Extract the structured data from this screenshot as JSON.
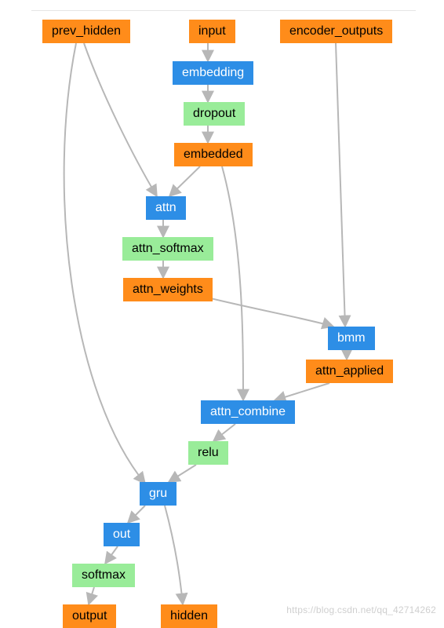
{
  "nodes": {
    "prev_hidden": {
      "label": "prev_hidden",
      "color": "orange"
    },
    "input": {
      "label": "input",
      "color": "orange"
    },
    "encoder_outputs": {
      "label": "encoder_outputs",
      "color": "orange"
    },
    "embedding": {
      "label": "embedding",
      "color": "blue"
    },
    "dropout": {
      "label": "dropout",
      "color": "green"
    },
    "embedded": {
      "label": "embedded",
      "color": "orange"
    },
    "attn": {
      "label": "attn",
      "color": "blue"
    },
    "attn_softmax": {
      "label": "attn_softmax",
      "color": "green"
    },
    "attn_weights": {
      "label": "attn_weights",
      "color": "orange"
    },
    "bmm": {
      "label": "bmm",
      "color": "blue"
    },
    "attn_applied": {
      "label": "attn_applied",
      "color": "orange"
    },
    "attn_combine": {
      "label": "attn_combine",
      "color": "blue"
    },
    "relu": {
      "label": "relu",
      "color": "green"
    },
    "gru": {
      "label": "gru",
      "color": "blue"
    },
    "out": {
      "label": "out",
      "color": "blue"
    },
    "softmax": {
      "label": "softmax",
      "color": "green"
    },
    "output": {
      "label": "output",
      "color": "orange"
    },
    "hidden": {
      "label": "hidden",
      "color": "orange"
    }
  },
  "edges": [
    [
      "input",
      "embedding"
    ],
    [
      "embedding",
      "dropout"
    ],
    [
      "dropout",
      "embedded"
    ],
    [
      "prev_hidden",
      "attn"
    ],
    [
      "embedded",
      "attn"
    ],
    [
      "attn",
      "attn_softmax"
    ],
    [
      "attn_softmax",
      "attn_weights"
    ],
    [
      "attn_weights",
      "bmm"
    ],
    [
      "encoder_outputs",
      "bmm"
    ],
    [
      "bmm",
      "attn_applied"
    ],
    [
      "embedded",
      "attn_combine"
    ],
    [
      "attn_applied",
      "attn_combine"
    ],
    [
      "attn_combine",
      "relu"
    ],
    [
      "relu",
      "gru"
    ],
    [
      "prev_hidden",
      "gru"
    ],
    [
      "gru",
      "out"
    ],
    [
      "out",
      "softmax"
    ],
    [
      "softmax",
      "output"
    ],
    [
      "gru",
      "hidden"
    ]
  ],
  "watermark": "https://blog.csdn.net/qq_42714262"
}
